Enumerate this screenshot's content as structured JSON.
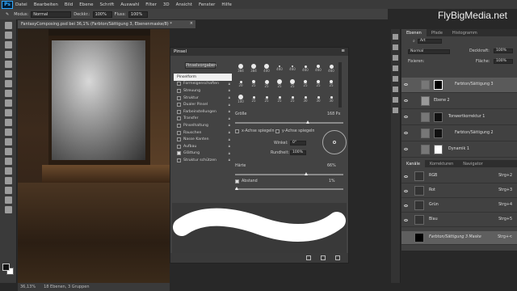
{
  "app": {
    "logo": "Ps",
    "watermark": "FlyBigMedia.net"
  },
  "menu": [
    "Datei",
    "Bearbeiten",
    "Bild",
    "Ebene",
    "Schrift",
    "Auswahl",
    "Filter",
    "3D",
    "Ansicht",
    "Fenster",
    "Hilfe"
  ],
  "options_bar": {
    "mode_label": "Modus:",
    "mode_value": "Normal",
    "opacity_label": "Deckkr.:",
    "opacity_value": "100%",
    "flow_label": "Fluss:",
    "flow_value": "100%"
  },
  "document": {
    "tab_title": "FantasyComposing.psd bei 36,1% (Farbton/Sättigung 3, Ebenenmaske/8) *",
    "close": "×",
    "zoom": "36,13%",
    "status": "18 Ebenen, 3 Gruppen"
  },
  "brush_panel": {
    "title": "Pinsel",
    "presets_button": "Pinselvorgaben",
    "options": [
      {
        "label": "Pinselform",
        "active": true,
        "checkbox": false
      },
      {
        "label": "Formeigenschaften",
        "checked": false
      },
      {
        "label": "Streuung",
        "checked": false
      },
      {
        "label": "Struktur",
        "checked": false
      },
      {
        "label": "Dualer Pinsel",
        "checked": false
      },
      {
        "label": "Farbeinstellungen",
        "checked": false
      },
      {
        "label": "Transfer",
        "checked": false
      },
      {
        "label": "Pinselhaltung",
        "checked": false
      },
      {
        "label": "Rauschen",
        "checked": false
      },
      {
        "label": "Nasse Kanten",
        "checked": false
      },
      {
        "label": "Aufbau",
        "checked": false
      },
      {
        "label": "Glättung",
        "checked": true
      },
      {
        "label": "Struktur schützen",
        "checked": false
      }
    ],
    "tips_row1": [
      "384",
      "384",
      "400",
      "460",
      "460",
      "460",
      "460",
      "460"
    ],
    "tips_row2": [
      "20",
      "25",
      "25",
      "25",
      "25",
      "25",
      "25",
      "25"
    ],
    "tips_row3": [
      "100",
      "25",
      "25",
      "25",
      "25",
      "30",
      "30",
      "30"
    ],
    "size_label": "Größe",
    "size_value": "168 Px",
    "flip_x": "x-Achse spiegeln",
    "flip_y": "y-Achse spiegeln",
    "angle_label": "Winkel:",
    "angle_value": "0°",
    "roundness_label": "Rundheit:",
    "roundness_value": "100%",
    "hardness_label": "Härte",
    "hardness_value": "66%",
    "spacing_label": "Abstand",
    "spacing_value": "1%"
  },
  "layers_panel": {
    "tabs": [
      "Ebenen",
      "Pfade",
      "Histogramm"
    ],
    "kind_label": "Art",
    "blend_mode": "Normal",
    "opacity_label": "Deckkraft:",
    "opacity_value": "100%",
    "fill_label": "Fläche:",
    "fill_value": "100%",
    "lock_label": "Fixieren:",
    "layers": [
      "Farbton/Sättigung 3",
      "Ebene 2",
      "Tonwertkorrektur 1",
      "Farbton/Sättigung 2",
      "Dynamik 1"
    ]
  },
  "channels_panel": {
    "tabs": [
      "Kanäle",
      "Korrekturen",
      "Navigator"
    ],
    "channels": [
      {
        "name": "RGB",
        "shortcut": "Strg+2"
      },
      {
        "name": "Rot",
        "shortcut": "Strg+3"
      },
      {
        "name": "Grün",
        "shortcut": "Strg+4"
      },
      {
        "name": "Blau",
        "shortcut": "Strg+5"
      },
      {
        "name": "Farbton/Sättigung 3 Maske",
        "shortcut": "Strg+<"
      }
    ]
  }
}
